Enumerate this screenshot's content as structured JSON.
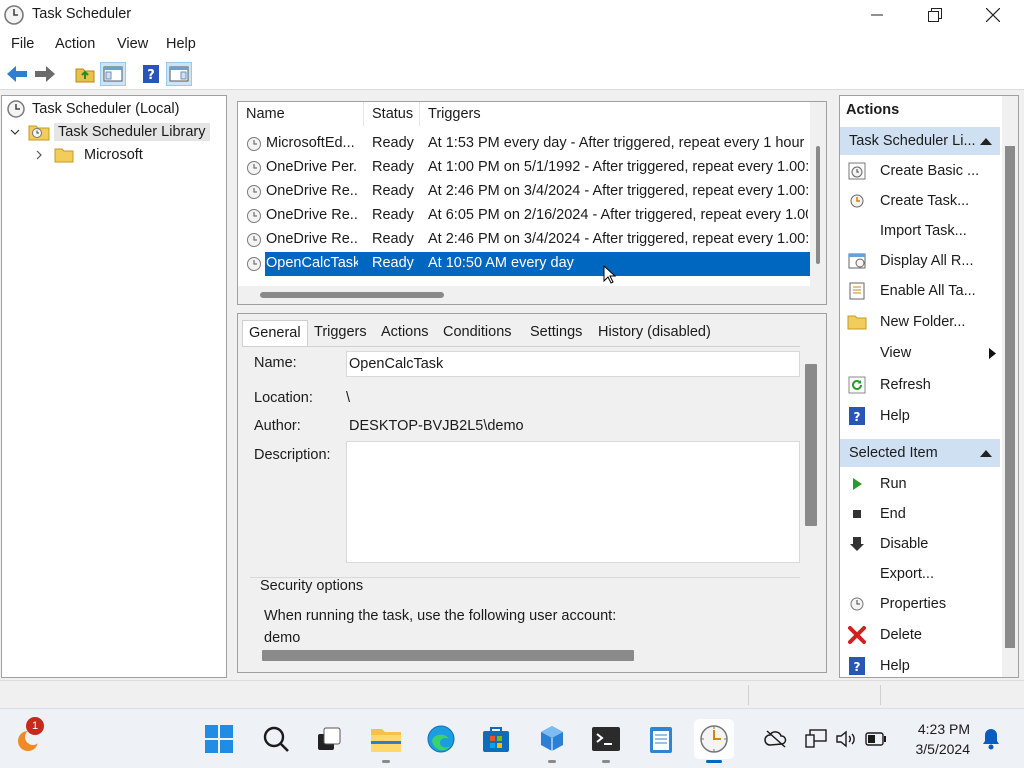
{
  "window": {
    "title": "Task Scheduler"
  },
  "menu": [
    "File",
    "Action",
    "View",
    "Help"
  ],
  "tree": {
    "root": "Task Scheduler (Local)",
    "library": "Task Scheduler Library",
    "child": "Microsoft"
  },
  "task_list": {
    "columns": [
      "Name",
      "Status",
      "Triggers"
    ],
    "rows": [
      {
        "name": "MicrosoftEd...",
        "status": "Ready",
        "trigger": "At 1:53 PM every day - After triggered, repeat every 1 hour"
      },
      {
        "name": "OneDrive Per...",
        "status": "Ready",
        "trigger": "At 1:00 PM on 5/1/1992 - After triggered, repeat every 1.00:0"
      },
      {
        "name": "OneDrive Re...",
        "status": "Ready",
        "trigger": "At 2:46 PM on 3/4/2024 - After triggered, repeat every 1.00:0"
      },
      {
        "name": "OneDrive Re...",
        "status": "Ready",
        "trigger": "At 6:05 PM on 2/16/2024 - After triggered, repeat every 1.00"
      },
      {
        "name": "OneDrive Re...",
        "status": "Ready",
        "trigger": "At 2:46 PM on 3/4/2024 - After triggered, repeat every 1.00:0"
      },
      {
        "name": "OpenCalcTask",
        "status": "Ready",
        "trigger": "At 10:50 AM every day"
      }
    ]
  },
  "detail": {
    "tabs": [
      "General",
      "Triggers",
      "Actions",
      "Conditions",
      "Settings",
      "History (disabled)"
    ],
    "name_label": "Name:",
    "name_value": "OpenCalcTask",
    "location_label": "Location:",
    "location_value": "\\",
    "author_label": "Author:",
    "author_value": "DESKTOP-BVJB2L5\\demo",
    "description_label": "Description:",
    "security_title": "Security options",
    "security_text": "When running the task, use the following user account:",
    "security_account": "demo"
  },
  "actions_pane": {
    "title": "Actions",
    "group1_title": "Task Scheduler Li...",
    "group1_items": [
      "Create Basic ...",
      "Create Task...",
      "Import Task...",
      "Display All R...",
      "Enable All Ta...",
      "New Folder...",
      "View",
      "Refresh",
      "Help"
    ],
    "group2_title": "Selected Item",
    "group2_items": [
      "Run",
      "End",
      "Disable",
      "Export...",
      "Properties",
      "Delete",
      "Help"
    ]
  },
  "taskbar": {
    "notification_count": "1",
    "time": "4:23 PM",
    "date": "3/5/2024"
  },
  "colors": {
    "selection": "#0067c0",
    "group_header": "#cfe0f3",
    "accent": "#0067c0"
  }
}
